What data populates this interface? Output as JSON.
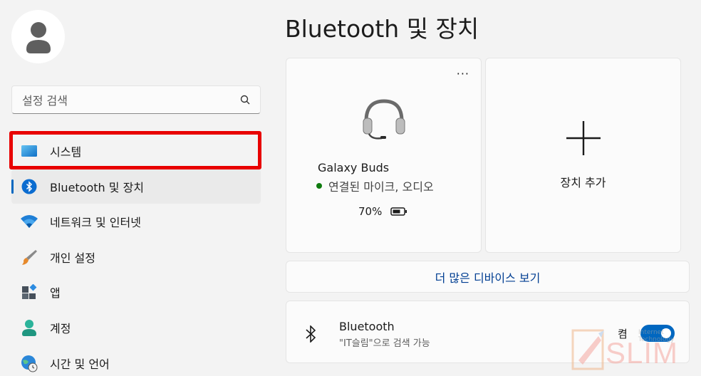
{
  "sidebar": {
    "search_placeholder": "설정 검색",
    "items": [
      {
        "label": "시스템",
        "icon": "system-icon"
      },
      {
        "label": "Bluetooth 및 장치",
        "icon": "bluetooth-icon",
        "active": true
      },
      {
        "label": "네트워크 및 인터넷",
        "icon": "network-icon"
      },
      {
        "label": "개인 설정",
        "icon": "personalization-icon"
      },
      {
        "label": "앱",
        "icon": "apps-icon"
      },
      {
        "label": "계정",
        "icon": "account-icon"
      },
      {
        "label": "시간 및 언어",
        "icon": "time-language-icon"
      }
    ],
    "highlight_color": "#e80000"
  },
  "main": {
    "title": "Bluetooth 및 장치",
    "device": {
      "name": "Galaxy Buds",
      "status": "연결된 마이크, 오디오",
      "battery": "70%",
      "more": "···"
    },
    "add_device": {
      "label": "장치 추가"
    },
    "more_devices_link": "더 많은 디바이스 보기",
    "bluetooth": {
      "title": "Bluetooth",
      "subtitle": "\"IT슬림\"으로 검색 가능",
      "toggle_label": "켬",
      "on": true
    }
  },
  "watermark": {
    "text": "SLIM",
    "small": "Internet Technology"
  },
  "colors": {
    "accent": "#0067c0",
    "link": "#003e92",
    "connected": "#0f7b0f"
  }
}
